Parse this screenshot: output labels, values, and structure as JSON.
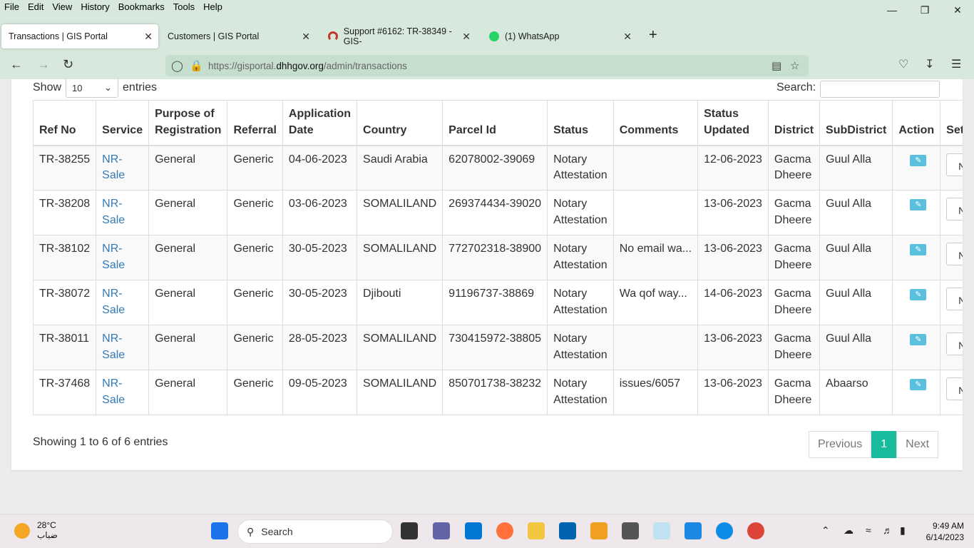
{
  "menu": [
    "File",
    "Edit",
    "View",
    "History",
    "Bookmarks",
    "Tools",
    "Help"
  ],
  "tabs": [
    {
      "label": "Transactions | GIS Portal"
    },
    {
      "label": "Customers | GIS Portal"
    },
    {
      "label": "Support #6162: TR-38349 - GIS-"
    },
    {
      "label": "(1) WhatsApp"
    }
  ],
  "url": {
    "prefix": "https://gisportal.",
    "domain": "dhhgov.org",
    "path": "/admin/transactions"
  },
  "controls": {
    "show_label": "Show",
    "entries_value": "10",
    "entries_label": "entries",
    "search_label": "Search:"
  },
  "table": {
    "headers": [
      "Ref No",
      "Service",
      "Purpose of Registration",
      "Referral",
      "Application Date",
      "Country",
      "Parcel Id",
      "Status",
      "Comments",
      "Status Updated",
      "District",
      "SubDistrict",
      "Action",
      "Set P"
    ],
    "rows": [
      {
        "ref": "TR-38255",
        "service": "NR-Sale",
        "purpose": "General",
        "referral": "Generic",
        "date": "04-06-2023",
        "country": "Saudi Arabia",
        "parcel": "62078002-39069",
        "status": "Notary Attestation",
        "comments": "",
        "updated": "12-06-2023",
        "district": "Gacma Dheere",
        "subdistrict": "Guul Alla",
        "set": "Nor"
      },
      {
        "ref": "TR-38208",
        "service": "NR-Sale",
        "purpose": "General",
        "referral": "Generic",
        "date": "03-06-2023",
        "country": "SOMALILAND",
        "parcel": "269374434-39020",
        "status": "Notary Attestation",
        "comments": "",
        "updated": "13-06-2023",
        "district": "Gacma Dheere",
        "subdistrict": "Guul Alla",
        "set": "Nor"
      },
      {
        "ref": "TR-38102",
        "service": "NR-Sale",
        "purpose": "General",
        "referral": "Generic",
        "date": "30-05-2023",
        "country": "SOMALILAND",
        "parcel": "772702318-38900",
        "status": "Notary Attestation",
        "comments": "No email wa...",
        "updated": "13-06-2023",
        "district": "Gacma Dheere",
        "subdistrict": "Guul Alla",
        "set": "Nor"
      },
      {
        "ref": "TR-38072",
        "service": "NR-Sale",
        "purpose": "General",
        "referral": "Generic",
        "date": "30-05-2023",
        "country": "Djibouti",
        "parcel": "91196737-38869",
        "status": "Notary Attestation",
        "comments": "Wa qof way...",
        "updated": "14-06-2023",
        "district": "Gacma Dheere",
        "subdistrict": "Guul Alla",
        "set": "Nor"
      },
      {
        "ref": "TR-38011",
        "service": "NR-Sale",
        "purpose": "General",
        "referral": "Generic",
        "date": "28-05-2023",
        "country": "SOMALILAND",
        "parcel": "730415972-38805",
        "status": "Notary Attestation",
        "comments": "",
        "updated": "13-06-2023",
        "district": "Gacma Dheere",
        "subdistrict": "Guul Alla",
        "set": "Nor"
      },
      {
        "ref": "TR-37468",
        "service": "NR-Sale",
        "purpose": "General",
        "referral": "Generic",
        "date": "09-05-2023",
        "country": "SOMALILAND",
        "parcel": "850701738-38232",
        "status": "Notary Attestation",
        "comments": "issues/6057",
        "updated": "13-06-2023",
        "district": "Gacma Dheere",
        "subdistrict": "Abaarso",
        "set": "Nor"
      }
    ]
  },
  "footer": {
    "info": "Showing 1 to 6 of 6 entries",
    "prev": "Previous",
    "page": "1",
    "next": "Next"
  },
  "taskbar": {
    "temp": "28°C",
    "weather": "ضباب",
    "search": "Search",
    "time": "9:49 AM",
    "date": "6/14/2023"
  },
  "colors": {
    "accent": "#18bc9c",
    "link": "#337ab7",
    "edit": "#5bc0de",
    "chrome": "#d7e8dc"
  }
}
